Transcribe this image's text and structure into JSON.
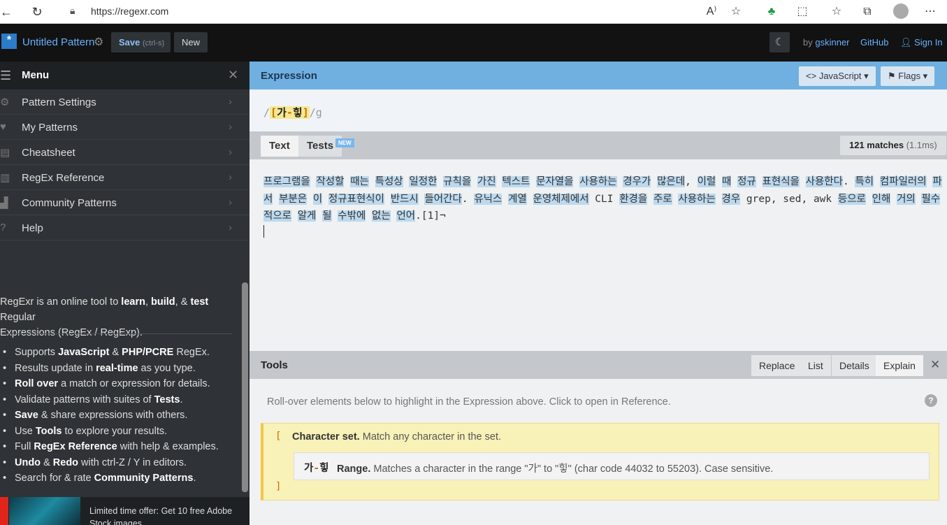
{
  "browser": {
    "url": "https://regexr.com",
    "icons": [
      "back-icon",
      "refresh-icon",
      "lock-icon",
      "read-aloud-icon",
      "favorite-add-icon",
      "extension-green-icon",
      "extensions-icon",
      "favorites-icon",
      "collections-icon",
      "profile-icon",
      "more-icon"
    ]
  },
  "header": {
    "pattern_title": "Untitled Pattern",
    "save_label": "Save",
    "save_hint": "(ctrl-s)",
    "new_label": "New",
    "by_label": "by",
    "author": "gskinner",
    "github_label": "GitHub",
    "signin_label": "Sign In"
  },
  "sidebar": {
    "menu_title": "Menu",
    "items": [
      {
        "label": "Pattern Settings",
        "icon": "gear-icon"
      },
      {
        "label": "My Patterns",
        "icon": "heart-icon"
      },
      {
        "label": "Cheatsheet",
        "icon": "document-icon"
      },
      {
        "label": "RegEx Reference",
        "icon": "book-icon"
      },
      {
        "label": "Community Patterns",
        "icon": "community-icon"
      },
      {
        "label": "Help",
        "icon": "help-icon"
      }
    ],
    "desc": {
      "p1": "RegExr is an online tool to ",
      "b1": "learn",
      "p2": ", ",
      "b2": "build",
      "p3": ", & ",
      "b3": "test",
      "p4": " Regular",
      "p5": "Expressions (RegEx / RegExp)."
    },
    "features": [
      {
        "pre": "Supports ",
        "b": "JavaScript",
        "mid": " & ",
        "b2": "PHP/PCRE",
        "post": " RegEx."
      },
      {
        "pre": "Results update in ",
        "b": "real-time",
        "mid": "",
        "b2": "",
        "post": " as you type."
      },
      {
        "pre": "",
        "b": "Roll over",
        "mid": "",
        "b2": "",
        "post": " a match or expression for details."
      },
      {
        "pre": "Validate patterns with suites of ",
        "b": "Tests",
        "mid": "",
        "b2": "",
        "post": "."
      },
      {
        "pre": "",
        "b": "Save",
        "mid": "",
        "b2": "",
        "post": " & share expressions with others."
      },
      {
        "pre": "Use ",
        "b": "Tools",
        "mid": "",
        "b2": "",
        "post": " to explore your results."
      },
      {
        "pre": "Full ",
        "b": "RegEx Reference",
        "mid": "",
        "b2": "",
        "post": " with help & examples."
      },
      {
        "pre": "",
        "b": "Undo",
        "mid": " & ",
        "b2": "Redo",
        "post": " with ctrl-Z / Y in editors."
      },
      {
        "pre": "Search for & rate ",
        "b": "Community Patterns",
        "mid": "",
        "b2": "",
        "post": "."
      }
    ],
    "ad_text": "Limited time offer: Get 10 free Adobe Stock images."
  },
  "expression": {
    "title": "Expression",
    "flavor_label": "JavaScript ▾",
    "flags_label": "Flags ▾",
    "open_delim": "/",
    "set_open": "[",
    "range_start": "가",
    "range_dash": "-",
    "range_end": "힣",
    "set_close": "]",
    "close_delim": "/g"
  },
  "text": {
    "tab_text": "Text",
    "tab_tests": "Tests",
    "new_badge": "NEW",
    "matches": "121 matches",
    "time": "(1.1ms)",
    "sample": "프로그램을 작성할 때는 특성상 일정한 규칙을 가진 텍스트 문자열을 사용하는 경우가 많은데, 이럴 때 정규 표현식을 사용한다. 특히 컴파일러의 파서 부분은 이 정규표현식이 반드시 들어간다. 유닉스 계열 운영체제에서 CLI 환경을 주로 사용하는 경우 grep, sed, awk 등으로 인해 거의 필수적으로 알게 될 수밖에 없는 언어.[1]¬"
  },
  "tools": {
    "title": "Tools",
    "tabs": [
      "Replace",
      "List",
      "Details",
      "Explain"
    ],
    "active_tab": "Explain",
    "rollover_hint": "Roll-over elements below to highlight in the Expression above. Click to open in Reference.",
    "set_open": "[",
    "set_close": "]",
    "set_title": "Character set.",
    "set_desc": " Match any character in the set.",
    "range_token_start": "가",
    "range_token_dash": "-",
    "range_token_end": "힣",
    "range_title": "Range.",
    "range_desc": " Matches a character in the range \"가\" to \"힣\" (char code 44032 to 55203). Case sensitive."
  },
  "colors": {
    "header_bg": "#121212",
    "sidebar_bg": "#2f3337",
    "expression_bar": "#6fb0e0",
    "match_highlight": "#bcd9ef",
    "explain_bg": "#f8f1b8",
    "link": "#66b1ff"
  }
}
